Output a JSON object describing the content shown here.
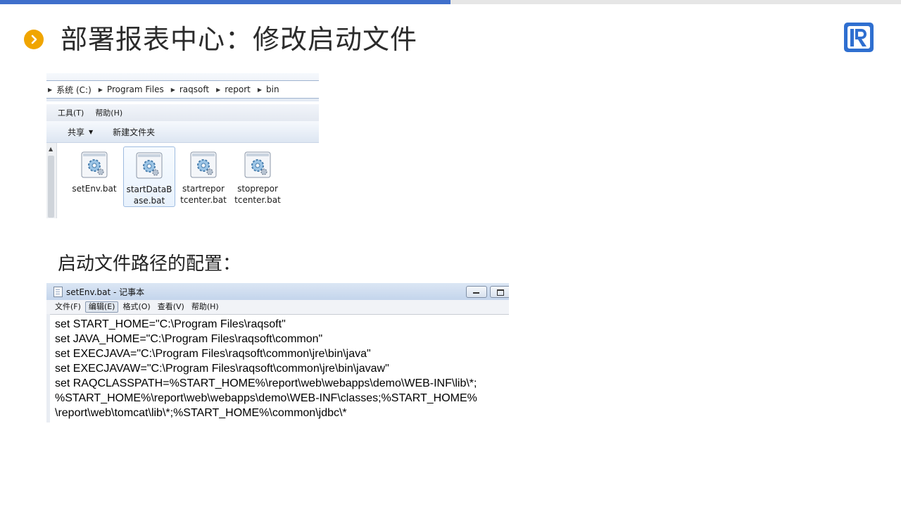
{
  "slide": {
    "title": "部署报表中心：修改启动文件",
    "section_label": "启动文件路径的配置：",
    "accent_color": "#3f6fcb",
    "bullet_color": "#f0a500",
    "bullet_icon": "chevron-right-icon",
    "logo_icon": "raqsoft-logo-icon"
  },
  "explorer": {
    "breadcrumb": [
      "系统 (C:)",
      "Program Files",
      "raqsoft",
      "report",
      "bin"
    ],
    "menu": [
      "工具(T)",
      "帮助(H)"
    ],
    "toolbar": {
      "share_label": "共享",
      "new_folder_label": "新建文件夹"
    },
    "files": [
      {
        "name": "setEnv.bat",
        "icon": "batch-file-gear-icon",
        "selected": false
      },
      {
        "name": "startDataB\nase.bat",
        "icon": "batch-file-gear-icon",
        "selected": true
      },
      {
        "name": "startrepor\ntcenter.bat",
        "icon": "batch-file-gear-icon",
        "selected": false
      },
      {
        "name": "stoprepor\ntcenter.bat",
        "icon": "batch-file-gear-icon",
        "selected": false
      }
    ]
  },
  "notepad": {
    "title": "setEnv.bat - 记事本",
    "menu": [
      "文件(F)",
      "编辑(E)",
      "格式(O)",
      "查看(V)",
      "帮助(H)"
    ],
    "active_menu": "编辑(E)",
    "lines": [
      "set START_HOME=\"C:\\Program Files\\raqsoft\"",
      "set JAVA_HOME=\"C:\\Program Files\\raqsoft\\common\"",
      "set EXECJAVA=\"C:\\Program Files\\raqsoft\\common\\jre\\bin\\java\"",
      "set EXECJAVAW=\"C:\\Program Files\\raqsoft\\common\\jre\\bin\\javaw\"",
      "set RAQCLASSPATH=%START_HOME%\\report\\web\\webapps\\demo\\WEB-INF\\lib\\*;",
      "%START_HOME%\\report\\web\\webapps\\demo\\WEB-INF\\classes;%START_HOME%",
      "\\report\\web\\tomcat\\lib\\*;%START_HOME%\\common\\jdbc\\*"
    ]
  }
}
